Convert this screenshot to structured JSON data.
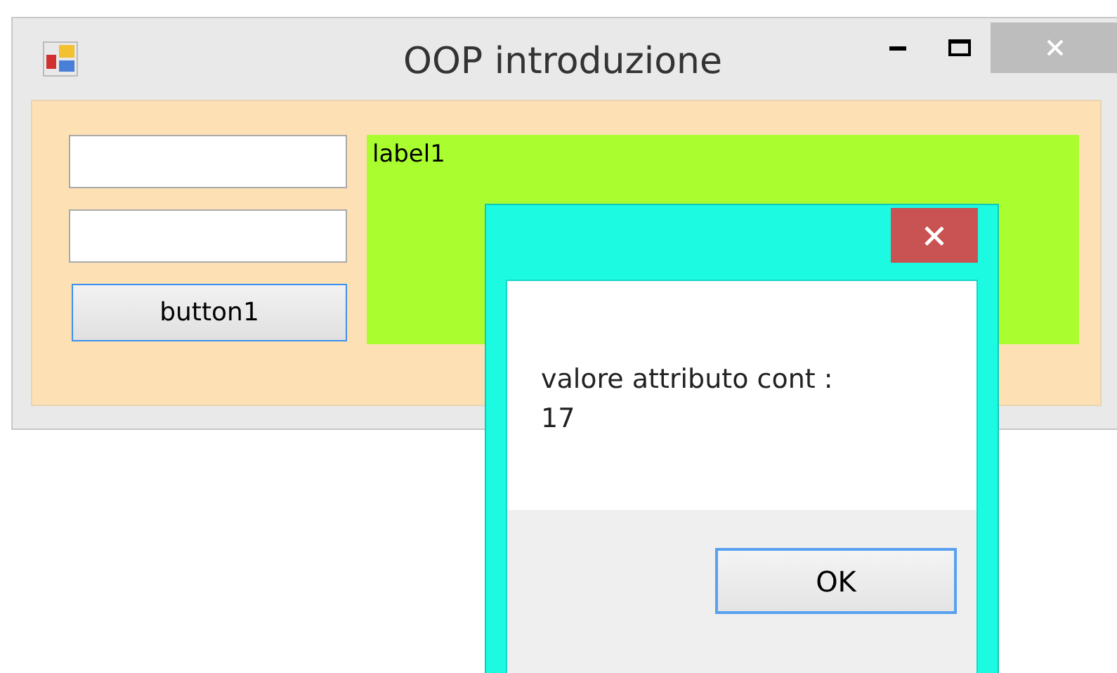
{
  "window": {
    "title": "OOP introduzione"
  },
  "form": {
    "fields": [
      {
        "kind": "textbox"
      },
      {
        "kind": "textbox"
      }
    ],
    "button": "button1",
    "label": "label1"
  },
  "dialog": {
    "message": "valore attributo cont :",
    "value": "17",
    "button": "OK"
  }
}
